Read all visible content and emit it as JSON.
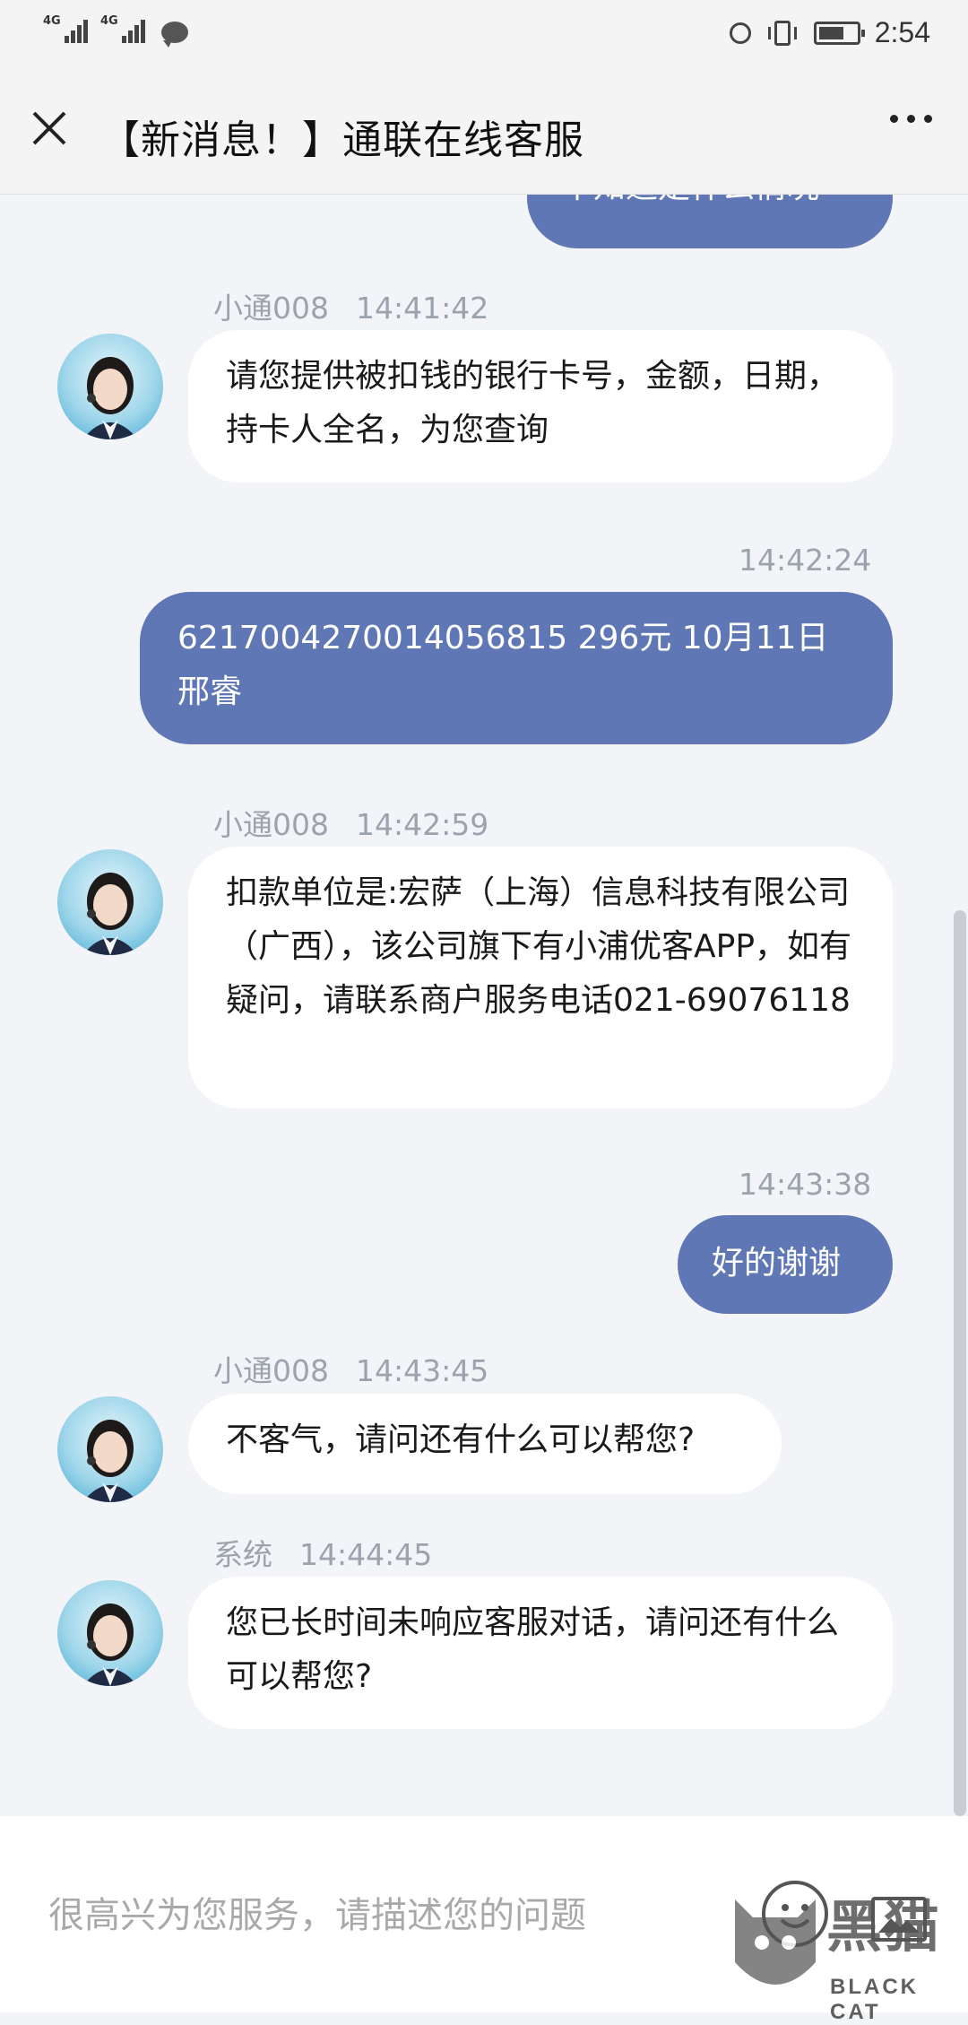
{
  "status_bar": {
    "network_1": "4G",
    "network_2": "4G",
    "time": "2:54",
    "icons": [
      "signal-icon",
      "signal-icon",
      "message-icon",
      "alarm-icon",
      "vibrate-icon",
      "battery-icon"
    ]
  },
  "header": {
    "title": "【新消息！】通联在线客服",
    "close_icon": "close-icon",
    "more_icon": "more-icon"
  },
  "messages": [
    {
      "direction": "out",
      "text": "不知道是什么情况"
    },
    {
      "direction": "in",
      "sender": "小通008",
      "time": "14:41:42",
      "text": "请您提供被扣钱的银行卡号，金额，日期，持卡人全名，为您查询"
    },
    {
      "direction": "out",
      "time": "14:42:24",
      "text": "6217004270014056815 296元 10月11日 邢睿"
    },
    {
      "direction": "in",
      "sender": "小通008",
      "time": "14:42:59",
      "text": "扣款单位是:宏萨（上海）信息科技有限公司（广西），该公司旗下有小浦优客APP，如有疑问，请联系商户服务电话021-69076118"
    },
    {
      "direction": "out",
      "time": "14:43:38",
      "text": "好的谢谢"
    },
    {
      "direction": "in",
      "sender": "小通008",
      "time": "14:43:45",
      "text": "不客气，请问还有什么可以帮您?"
    },
    {
      "direction": "in",
      "sender": "系统",
      "time": "14:44:45",
      "text": "您已长时间未响应客服对话，请问还有什么可以帮您?"
    }
  ],
  "input": {
    "placeholder": "很高兴为您服务，请描述您的问题"
  },
  "watermark": {
    "text": "黑猫",
    "sub": "BLACK CAT"
  },
  "colors": {
    "outgoing_bubble": "#5f78b5",
    "incoming_bubble": "#ffffff",
    "background": "#f2f4f8"
  }
}
